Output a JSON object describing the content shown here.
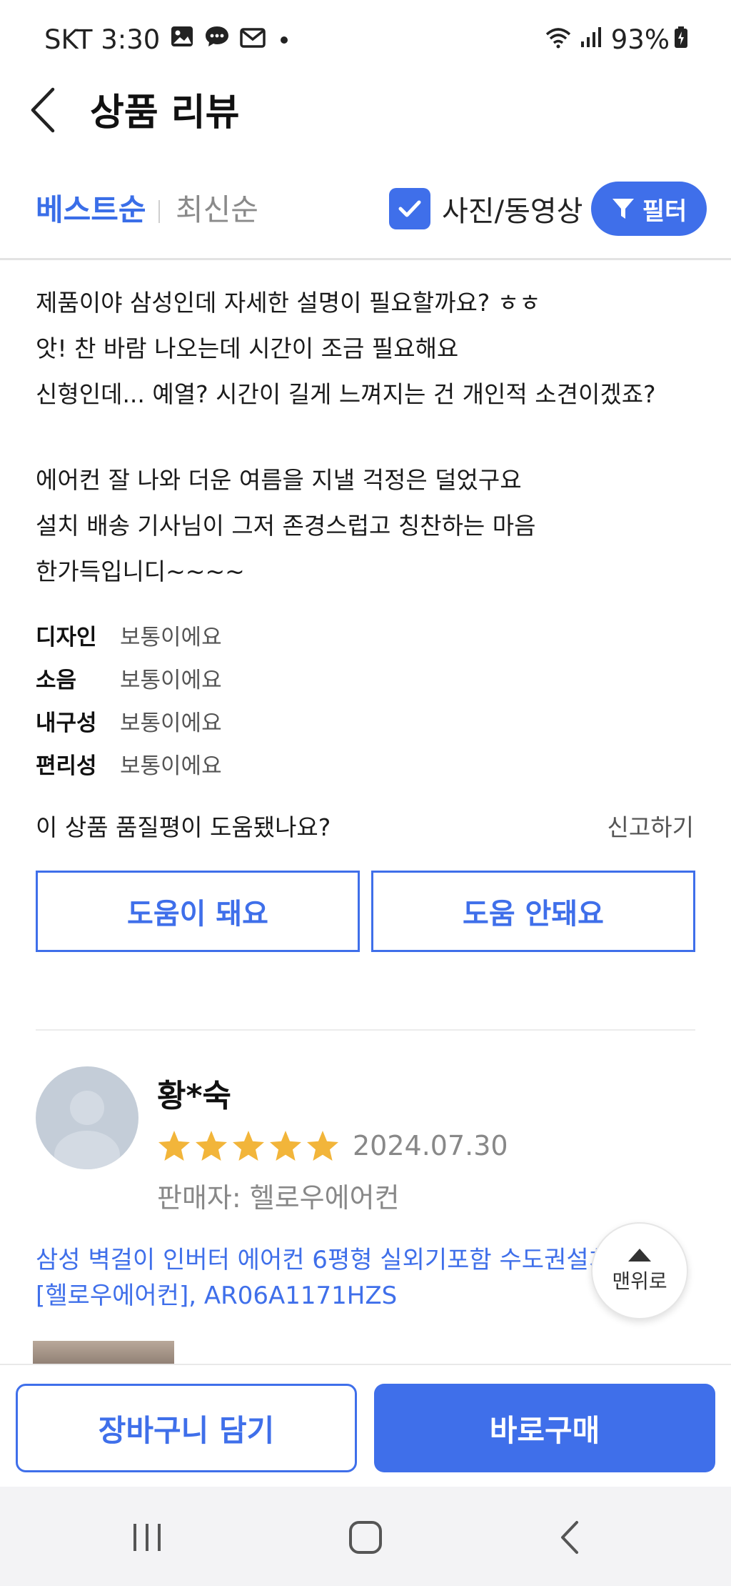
{
  "status_bar": {
    "carrier_time": "SKT 3:30",
    "battery": "93%"
  },
  "header": {
    "title": "상품 리뷰"
  },
  "sort_bar": {
    "best": "베스트순",
    "latest": "최신순",
    "photo_video": "사진/동영상",
    "photo_video_checked": true,
    "filter": "필터"
  },
  "review1": {
    "lines": [
      "제품이야 삼성인데 자세한 설명이 필요할까요? ㅎㅎ",
      "앗! 찬 바람 나오는데 시간이 조금 필요해요",
      "신형인데... 예열? 시간이 길게 느껴지는 건 개인적 소견이겠죠?",
      "에어컨 잘 나와 더운 여름을 지낼 걱정은 덜었구요",
      "설치 배송 기사님이 그저 존경스럽고 칭찬하는 마음",
      "한가득입니디~~~~"
    ],
    "attributes": [
      {
        "key": "디자인",
        "value": "보통이에요"
      },
      {
        "key": "소음",
        "value": "보통이에요"
      },
      {
        "key": "내구성",
        "value": "보통이에요"
      },
      {
        "key": "편리성",
        "value": "보통이에요"
      }
    ],
    "helpful_question": "이 상품 품질평이 도움됐나요?",
    "report": "신고하기",
    "helpful_yes": "도움이 돼요",
    "helpful_no": "도움 안돼요"
  },
  "review2": {
    "reviewer": "황*숙",
    "rating": 5,
    "rating_max": 5,
    "date": "2024.07.30",
    "seller": "판매자: 헬로우에어컨",
    "product_line1": "삼성 벽걸이 인버터 에어컨 6평형 실외기포함 수도권설치",
    "product_line2": "[헬로우에어컨], AR06A1171HZS"
  },
  "to_top": "맨위로",
  "actions": {
    "cart": "장바구니 담기",
    "buy": "바로구매"
  },
  "colors": {
    "accent": "#3f6fea",
    "star": "#f2b53a"
  }
}
